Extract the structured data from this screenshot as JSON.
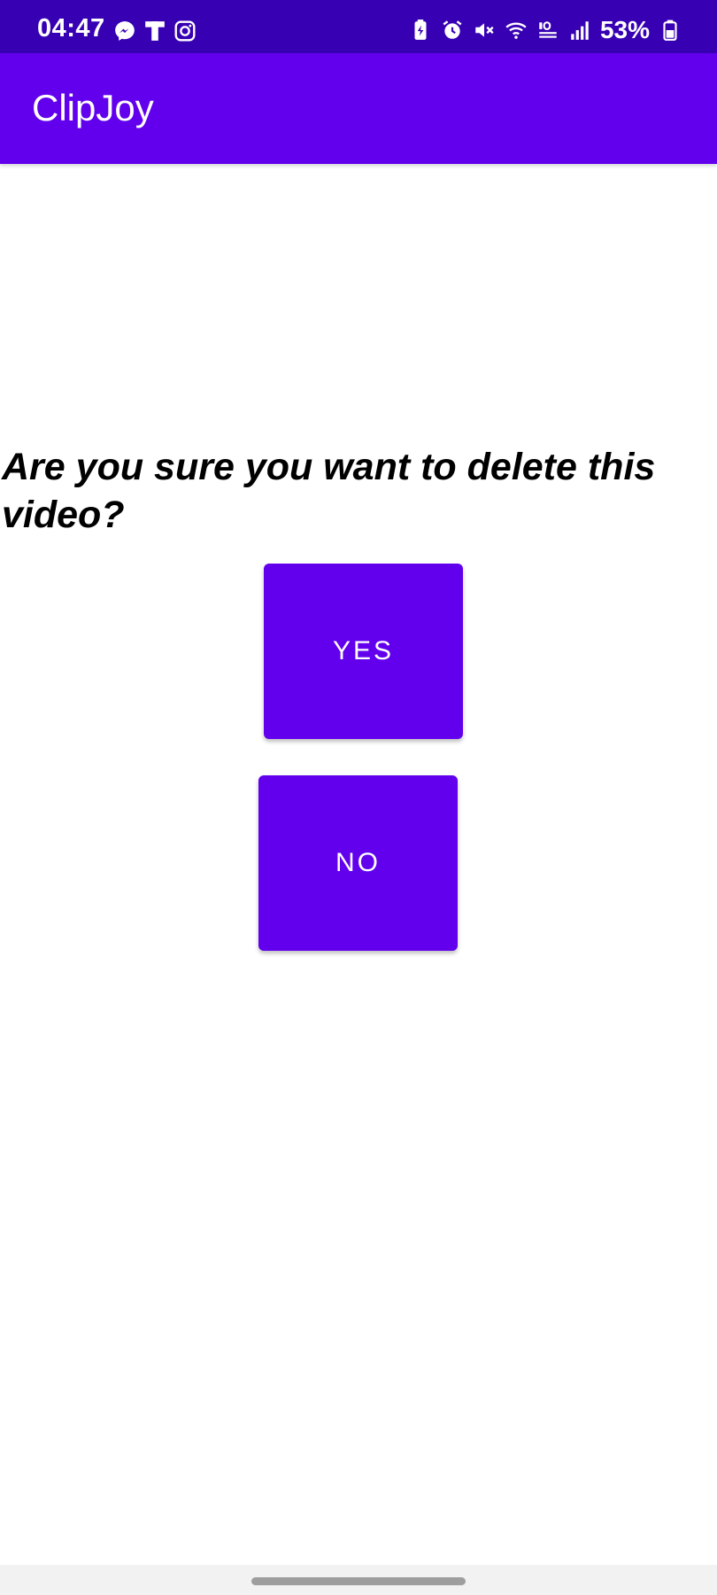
{
  "status_bar": {
    "time": "04:47",
    "battery": "53%",
    "left_icons": [
      "messenger-icon",
      "t-app-icon",
      "instagram-icon"
    ],
    "right_icons": [
      "battery-saver-icon",
      "alarm-icon",
      "mute-icon",
      "wifi-icon",
      "volte-icon",
      "signal-icon",
      "battery-icon"
    ],
    "background": "#3700b3"
  },
  "app_bar": {
    "title": "ClipJoy",
    "background": "#6200ee"
  },
  "dialog": {
    "question": "Are you sure you want to delete this video?",
    "yes_label": "YES",
    "no_label": "NO",
    "button_color": "#6200ee"
  }
}
